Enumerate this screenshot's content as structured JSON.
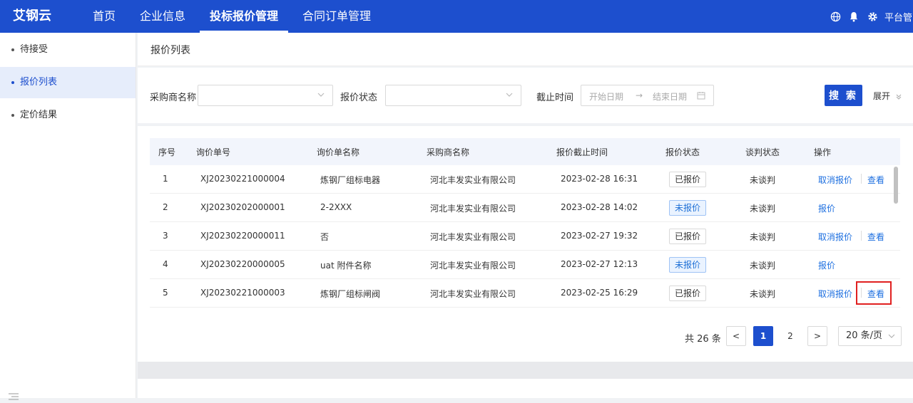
{
  "topnav": {
    "brand": "艾钢云",
    "items": [
      "首页",
      "企业信息",
      "投标报价管理",
      "合同订单管理"
    ],
    "active_index": 2,
    "user": "平台管..."
  },
  "sidebar": {
    "items": [
      "待接受",
      "报价列表",
      "定价结果"
    ],
    "active_index": 1
  },
  "page": {
    "title": "报价列表"
  },
  "filter": {
    "purchaser_label": "采购商名称",
    "purchaser_value": "",
    "status_label": "报价状态",
    "status_value": "",
    "deadline_label": "截止时间",
    "start_placeholder": "开始日期",
    "arrow": "→",
    "end_placeholder": "结束日期",
    "search_label": "搜 索",
    "expand_label": "展开"
  },
  "table": {
    "columns": [
      "序号",
      "询价单号",
      "询价单名称",
      "采购商名称",
      "报价截止时间",
      "报价状态",
      "谈判状态",
      "操作"
    ],
    "rows": [
      {
        "seq": "1",
        "no": "XJ20230221000004",
        "name": "炼钢厂组标电器",
        "buyer": "河北丰发实业有限公司",
        "deadline": "2023-02-28 16:31",
        "quote_status": "已报价",
        "quoted": true,
        "nego": "未谈判",
        "actions": [
          "取消报价",
          "查看"
        ]
      },
      {
        "seq": "2",
        "no": "XJ20230202000001",
        "name": "2-2XXX",
        "buyer": "河北丰发实业有限公司",
        "deadline": "2023-02-28 14:02",
        "quote_status": "未报价",
        "quoted": false,
        "nego": "未谈判",
        "actions": [
          "报价"
        ]
      },
      {
        "seq": "3",
        "no": "XJ20230220000011",
        "name": "否",
        "buyer": "河北丰发实业有限公司",
        "deadline": "2023-02-27 19:32",
        "quote_status": "已报价",
        "quoted": true,
        "nego": "未谈判",
        "actions": [
          "取消报价",
          "查看"
        ]
      },
      {
        "seq": "4",
        "no": "XJ20230220000005",
        "name": "uat 附件名称",
        "buyer": "河北丰发实业有限公司",
        "deadline": "2023-02-27 12:13",
        "quote_status": "未报价",
        "quoted": false,
        "nego": "未谈判",
        "actions": [
          "报价"
        ]
      },
      {
        "seq": "5",
        "no": "XJ20230221000003",
        "name": "炼钢厂组标闸阀",
        "buyer": "河北丰发实业有限公司",
        "deadline": "2023-02-25 16:29",
        "quote_status": "已报价",
        "quoted": true,
        "nego": "未谈判",
        "actions": [
          "取消报价",
          "查看"
        ]
      }
    ]
  },
  "pagination": {
    "total": "共 26 条",
    "prev": "<",
    "pages": [
      "1",
      "2"
    ],
    "current": "1",
    "next": ">",
    "page_size": "20 条/页"
  },
  "colors": {
    "primary": "#1d4fce",
    "link": "#1d6fe0",
    "highlight": "#e02020"
  }
}
